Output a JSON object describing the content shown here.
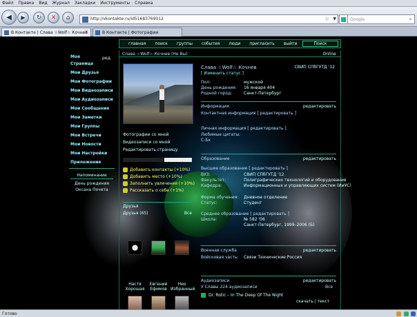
{
  "browser": {
    "menu": [
      "Файл",
      "Правка",
      "Вид",
      "Журнал",
      "Закладки",
      "Инструменты",
      "Справка"
    ],
    "url": "http://vkontakte.ru/id51683769012",
    "search_placeholder": "Google",
    "tabs": [
      "В Контакте | Слава ☆Wolf☆ Кочнев",
      "В Контакте | Фотографии"
    ],
    "status": "Готово"
  },
  "site": {
    "topnav": [
      "главная",
      "поиск",
      "группы",
      "события",
      "люди",
      "пригласить",
      "выйти"
    ],
    "search_button": "Поиск",
    "sidebar": {
      "edit": "ред.",
      "items": [
        "Моя Страница",
        "Мои Друзья",
        "Мои Фотографии",
        "Мои Видеозаписи",
        "Мои Аудиозаписи",
        "Мои Сообщения",
        "Мои Заметки",
        "Мои Группы",
        "Мои Встречи",
        "Мои Новости",
        "Мои Настройки",
        "Приложения"
      ],
      "reminder_title": "Напоминание",
      "reminder_text": "День рождения Оксана Почета"
    },
    "breadcrumb": "Слава ☆Wolf☆ Кочнев (Не Вы)",
    "online": "Online",
    "profile": {
      "name": "Слава ☆Wolf☆ Кочнев",
      "change_status": "[ Изменить статус ]",
      "university": "СВИП СПбГУТД '12",
      "info": [
        {
          "k": "Пол:",
          "v": "мужской"
        },
        {
          "k": "День рождения:",
          "v": "16 января 404"
        },
        {
          "k": "Родной город:",
          "v": "Санкт-Петербург"
        }
      ],
      "sections": {
        "info_title": "Информация",
        "contact_info": "Контактная информация   [ редактировать ]",
        "personal_info": "Личная информация   [ редактировать ]",
        "quotes": "Любимые цитаты:",
        "quotes_val": "С-Бк",
        "education_title": "Образование",
        "education_sub": "Высшее образование   [ редактировать ]",
        "military_title": "Военная служба",
        "audio_title": "Аудиозаписи",
        "edit": "редактировать",
        "all": "Все"
      },
      "education": [
        {
          "k": "ВУЗ:",
          "v": "СВИП СПбГУТД '12"
        },
        {
          "k": "Факультет:",
          "v": "Полиграфических технологий и оборудования"
        },
        {
          "k": "Кафедра:",
          "v": "Информационных и управляющих систем (ИиУС)"
        },
        {
          "k": "Форма обучения:",
          "v": "Дневное отделение"
        },
        {
          "k": "Статус:",
          "v": "Студент"
        }
      ],
      "school_title": "Среднее образование  [ редактировать ]",
      "school": {
        "k": "Школа:",
        "v": "№ 582 '06",
        "v2": "Санкт-Петербург, 1999–2006 (Б)"
      },
      "military": {
        "k": "Войсковая часть:",
        "v": "Связи Технические Россия"
      },
      "audio": {
        "count": "У Славы 224 аудиозаписи",
        "track": "Dr. Rotic – In The Deep Of The Night",
        "links": "скачать | текст"
      }
    },
    "left_col": {
      "links": [
        "Фотографии со мной",
        "Видеозаписи со мной",
        "Редактировать страницу"
      ],
      "rating": [
        "Добавить контакты (+10%)",
        "Добавить место (+10%)",
        "Заполнить увлечения (+10%)",
        "Рассказать о себе (+1%)"
      ],
      "rating_level": 0.6,
      "friends_title": "Друзья",
      "friends_count": "Друзья (65)",
      "friends_all": "Все",
      "friends": [
        "Настя Хорошая",
        "Евгений Ефимов",
        "Нео Избранный"
      ]
    }
  }
}
